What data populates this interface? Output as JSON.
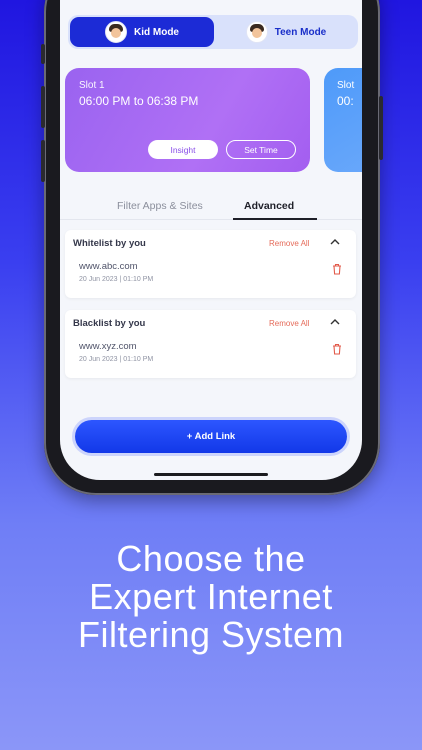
{
  "modes": [
    {
      "label": "Kid Mode",
      "active": true,
      "icon": "boy-avatar-icon"
    },
    {
      "label": "Teen Mode",
      "active": false,
      "icon": "teen-avatar-icon"
    }
  ],
  "slots": [
    {
      "title": "Slot 1",
      "time": "06:00 PM to 06:38 PM",
      "insight_label": "Insight",
      "set_time_label": "Set Time"
    },
    {
      "title": "Slot",
      "time": "00:"
    }
  ],
  "tabs": [
    {
      "label": "Filter Apps & Sites",
      "active": false
    },
    {
      "label": "Advanced",
      "active": true
    }
  ],
  "whitelist": {
    "title": "Whitelist by you",
    "remove_all": "Remove All",
    "items": [
      {
        "url": "www.abc.com",
        "date": "20 Jun 2023 | 01:10 PM"
      }
    ]
  },
  "blacklist": {
    "title": "Blacklist by you",
    "remove_all": "Remove All",
    "items": [
      {
        "url": "www.xyz.com",
        "date": "20 Jun 2023 | 01:10 PM"
      }
    ]
  },
  "add_link_label": "+ Add Link",
  "headline": {
    "line1": "Choose the",
    "line2": "Expert Internet",
    "line3": "Filtering System"
  },
  "colors": {
    "primary_blue": "#1c2bd6",
    "slot_purple": "#9a63f0",
    "remove_red": "#e56b5a"
  }
}
